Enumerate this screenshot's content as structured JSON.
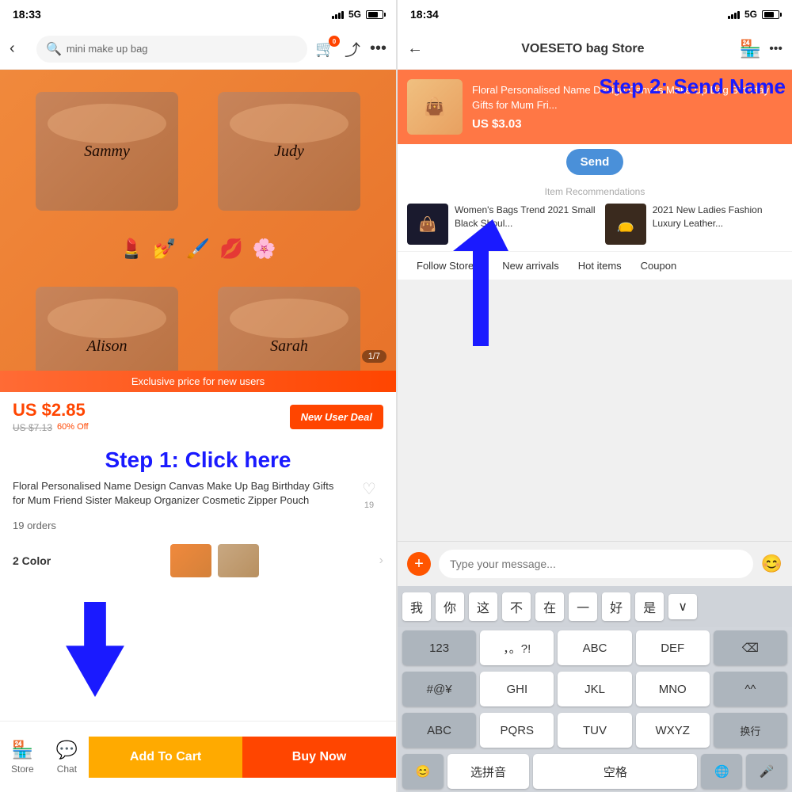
{
  "left": {
    "status_time": "18:33",
    "signal": "5G",
    "search_placeholder": "mini make up bag",
    "product_image_alt": "Personalised Name Design Canvas Make Up Bags",
    "page_indicator": "1/7",
    "exclusive_banner": "Exclusive price for new users",
    "current_price": "US $2.85",
    "original_price": "US $7.13",
    "discount": "60% Off",
    "new_user_deal": "New User Deal",
    "step1_text": "Step 1: Click here",
    "product_title": "Floral Personalised Name Design Canvas Make Up Bag Birthday Gifts for Mum Friend Sister Makeup Organizer Cosmetic Zipper Pouch",
    "wishlist_count": "19",
    "orders_text": "19 orders",
    "color_label": "2 Color",
    "nav_store": "Store",
    "nav_chat": "Chat",
    "add_to_cart": "Add To Cart",
    "buy_now": "Buy Now",
    "bag_names": [
      "Sammy",
      "Judy",
      "Alison",
      "Sarah"
    ],
    "cart_badge": "0"
  },
  "right": {
    "status_time": "18:34",
    "signal": "5G",
    "store_name": "VOESETO bag Store",
    "product_card_title": "Floral Personalised Name Design Canvas Make Up Bag Birthday Gifts for Mum Fri...",
    "product_card_price": "US $3.03",
    "send_button": "Send",
    "step2_text": "Step 2: Send Name",
    "item_recs_label": "Item Recommendations",
    "rec1_title": "Women's Bags Trend 2021 Small Black Shoul...",
    "rec2_title": "2021 New Ladies Fashion Luxury Leather...",
    "tab_follow": "Follow Store",
    "tab_arrivals": "New arrivals",
    "tab_hot": "Hot items",
    "tab_coupon": "Coupon",
    "chat_placeholder": "Type your message...",
    "quick_chars": [
      "我",
      "你",
      "这",
      "不",
      "在",
      "一",
      "好",
      "是",
      "↓"
    ],
    "key_row1": [
      "123",
      ",。?!",
      "ABC",
      "DEF",
      "⌫"
    ],
    "key_row2": [
      "#@¥",
      "GHI",
      "JKL",
      "MNO",
      "^^"
    ],
    "key_row3": [
      "ABC",
      "PQRS",
      "TUV",
      "WXYZ",
      "换行"
    ],
    "key_row4_left": "😊",
    "key_row4_mid": "选拼音",
    "key_row4_space": "空格",
    "key_row4_right": "",
    "bottom_icons": [
      "🌐",
      "🎤"
    ]
  }
}
